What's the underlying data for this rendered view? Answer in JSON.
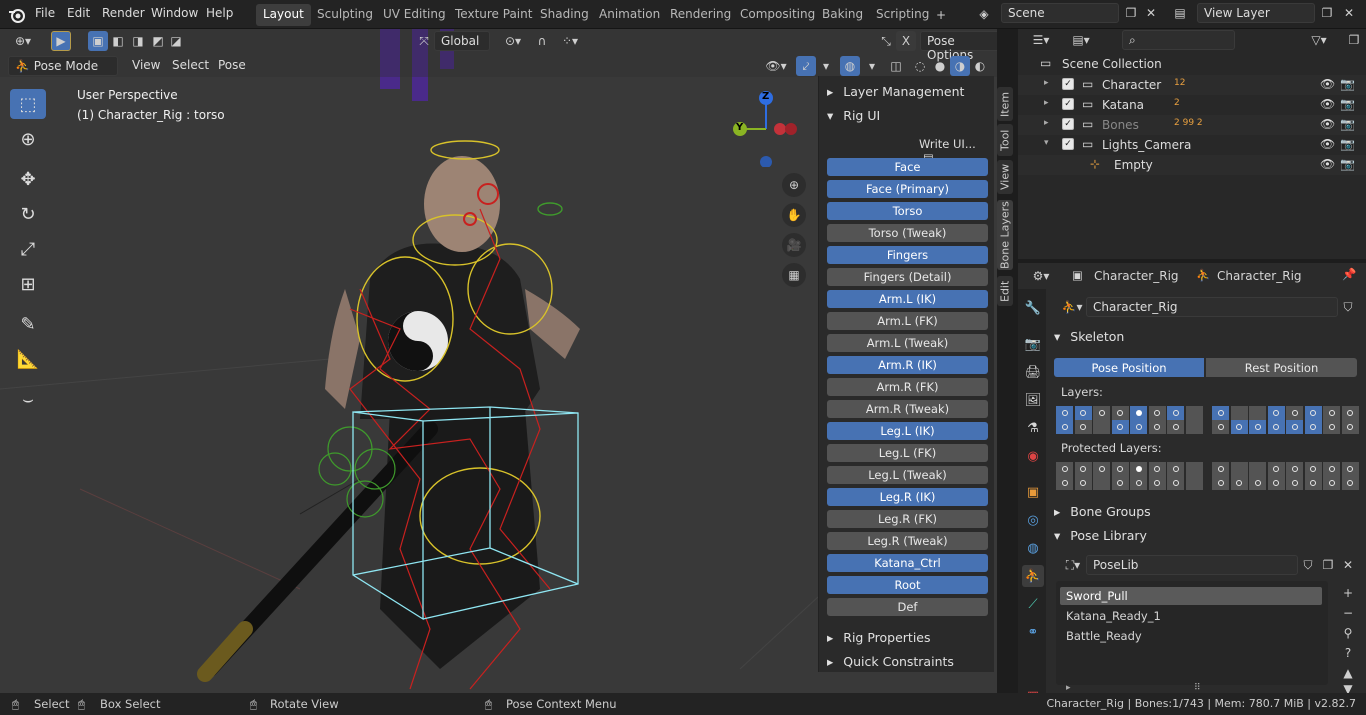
{
  "menubar": {
    "file": "File",
    "edit": "Edit",
    "render": "Render",
    "window": "Window",
    "help": "Help"
  },
  "workspaces": [
    "Layout",
    "Sculpting",
    "UV Editing",
    "Texture Paint",
    "Shading",
    "Animation",
    "Rendering",
    "Compositing",
    "Baking",
    "Scripting"
  ],
  "scene": {
    "name": "Scene",
    "view_layer": "View Layer"
  },
  "viewport_header": {
    "mode": "Pose Mode",
    "view": "View",
    "select": "Select",
    "pose": "Pose",
    "orientation": "Global",
    "pose_options": "Pose Options"
  },
  "viewport": {
    "perspective": "User Perspective",
    "object_info": "(1) Character_Rig : torso",
    "gizmo_z": "Z",
    "gizmo_y": "Y"
  },
  "npanel": {
    "layer_management": "Layer Management",
    "rig_ui": "Rig UI",
    "write_ui": "Write UI...",
    "buttons": [
      {
        "label": "Face",
        "on": true
      },
      {
        "label": "Face (Primary)",
        "on": true
      },
      {
        "label": "Torso",
        "on": true
      },
      {
        "label": "Torso (Tweak)",
        "on": false
      },
      {
        "label": "Fingers",
        "on": true
      },
      {
        "label": "Fingers (Detail)",
        "on": false
      },
      {
        "label": "Arm.L (IK)",
        "on": true
      },
      {
        "label": "Arm.L (FK)",
        "on": false
      },
      {
        "label": "Arm.L (Tweak)",
        "on": false
      },
      {
        "label": "Arm.R (IK)",
        "on": true
      },
      {
        "label": "Arm.R (FK)",
        "on": false
      },
      {
        "label": "Arm.R (Tweak)",
        "on": false
      },
      {
        "label": "Leg.L (IK)",
        "on": true
      },
      {
        "label": "Leg.L (FK)",
        "on": false
      },
      {
        "label": "Leg.L (Tweak)",
        "on": false
      },
      {
        "label": "Leg.R (IK)",
        "on": true
      },
      {
        "label": "Leg.R (FK)",
        "on": false
      },
      {
        "label": "Leg.R (Tweak)",
        "on": false
      },
      {
        "label": "Katana_Ctrl",
        "on": true
      },
      {
        "label": "Root",
        "on": true
      },
      {
        "label": "Def",
        "on": false
      }
    ],
    "rig_properties": "Rig Properties",
    "quick_constraints": "Quick Constraints",
    "tabs": {
      "item": "Item",
      "tool": "Tool",
      "view": "View",
      "bone_layers": "Bone Layers",
      "edit": "Edit"
    }
  },
  "outliner": {
    "root": "Scene Collection",
    "rows": [
      {
        "name": "Character",
        "badge": "12"
      },
      {
        "name": "Katana",
        "badge": "2"
      },
      {
        "name": "Bones",
        "badge": "2  99  2"
      },
      {
        "name": "Lights_Camera",
        "badge": ""
      },
      {
        "name": "Empty",
        "badge": ""
      }
    ]
  },
  "properties": {
    "crumb1": "Character_Rig",
    "crumb2": "Character_Rig",
    "armature_name": "Character_Rig",
    "skeleton": "Skeleton",
    "pose_position": "Pose Position",
    "rest_position": "Rest Position",
    "layers": "Layers:",
    "protected_layers": "Protected Layers:",
    "bone_groups": "Bone Groups",
    "pose_library": "Pose Library",
    "poselib_name": "PoseLib",
    "poses": [
      "Sword_Pull",
      "Katana_Ready_1",
      "Battle_Ready"
    ],
    "layers_on": [
      0,
      1,
      4,
      6,
      8,
      11,
      12,
      16,
      19,
      21,
      25,
      26,
      27,
      28,
      29
    ],
    "layers_marked": [
      4
    ],
    "protected_marked": [
      4
    ]
  },
  "status": {
    "select": "Select",
    "box_select": "Box Select",
    "rotate_view": "Rotate View",
    "context_menu": "Pose Context Menu",
    "info": "Character_Rig | Bones:1/743  | Mem: 780.7 MiB | v2.82.7"
  },
  "colors": {
    "accent": "#4772b3",
    "bg": "#393939",
    "panel": "#2a2a2a",
    "bone_yellow": "#d8c22a",
    "bone_red": "#c8211f",
    "bone_green": "#3f9a2c",
    "bone_box": "#8fe6f2"
  }
}
